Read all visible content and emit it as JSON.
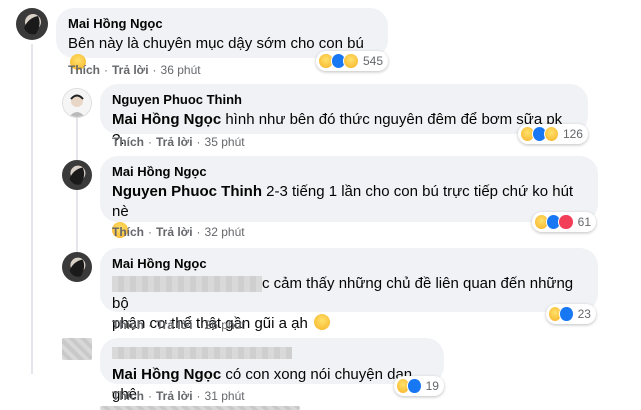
{
  "comments": [
    {
      "author": "Mai Hồng Ngọc",
      "text": "Bên này là chuyên mục dậy sớm cho con bú",
      "like_label": "Thích",
      "reply_label": "Trả lời",
      "time": "36 phút",
      "reaction_count": "545",
      "reactions": [
        "haha",
        "like",
        "haha"
      ]
    },
    {
      "author": "Nguyen Phuoc Thinh",
      "mention": "Mai Hồng Ngọc",
      "text": " hình như bên đó thức nguyên đêm để bơm sữa pk ?.",
      "like_label": "Thích",
      "reply_label": "Trả lời",
      "time": "35 phút",
      "reaction_count": "126",
      "reactions": [
        "haha",
        "like",
        "haha"
      ]
    },
    {
      "author": "Mai Hồng Ngọc",
      "mention": "Nguyen Phuoc Thinh",
      "text": " 2-3 tiếng 1 lần cho con bú trực tiếp chứ ko hút nè",
      "like_label": "Thích",
      "reply_label": "Trả lời",
      "time": "32 phút",
      "reaction_count": "61",
      "reactions": [
        "haha",
        "like",
        "love"
      ]
    },
    {
      "author": "Mai Hồng Ngọc",
      "text": "c cảm thấy những chủ đề liên quan đến những bộ",
      "text_line2": "phận cơ thể thật gần gũi a ạh",
      "like_label": "Thích",
      "reply_label": "Trả lời",
      "time": "26 phút",
      "reaction_count": "23",
      "reactions": [
        "haha",
        "like"
      ]
    },
    {
      "author": "",
      "mention": "Mai Hồng Ngọc",
      "text": " có con xong nói chuyện dạn ghê",
      "like_label": "Thích",
      "reply_label": "Trả lời",
      "time": "31 phút",
      "reaction_count": "19",
      "reactions": [
        "haha",
        "like"
      ]
    }
  ],
  "colors": {
    "bubble": "#f0f2f5",
    "meta": "#65676b",
    "like": "#1877f2",
    "love": "#f33e58",
    "haha": "#f7b125"
  }
}
